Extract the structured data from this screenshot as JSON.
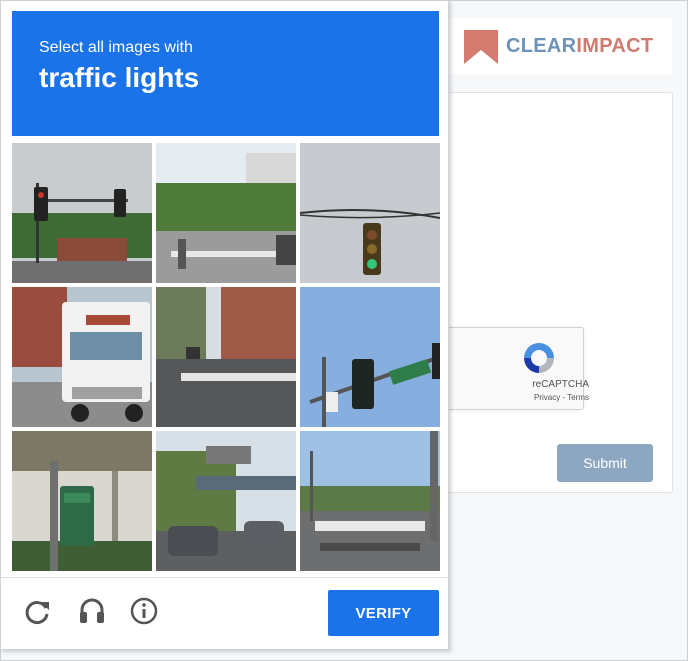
{
  "brand": {
    "word1": "CLEAR",
    "word2": "IMPACT"
  },
  "challenge": {
    "instruction": "Select all images with",
    "target": "traffic lights",
    "tiles": [
      "traffic-light-street",
      "crosswalk-pedestrian",
      "traffic-light-sky",
      "truck-building",
      "street-crosswalk",
      "traffic-signal-sign",
      "traffic-light-station",
      "overpass-cars",
      "crosswalk-poles"
    ],
    "icons": [
      "reload-icon",
      "headphones-icon",
      "info-icon"
    ],
    "verify_label": "VERIFY",
    "accent": "#1a73e8"
  },
  "recaptcha": {
    "name": "reCAPTCHA",
    "terms": "Privacy - Terms"
  },
  "form": {
    "submit_label": "Submit"
  }
}
